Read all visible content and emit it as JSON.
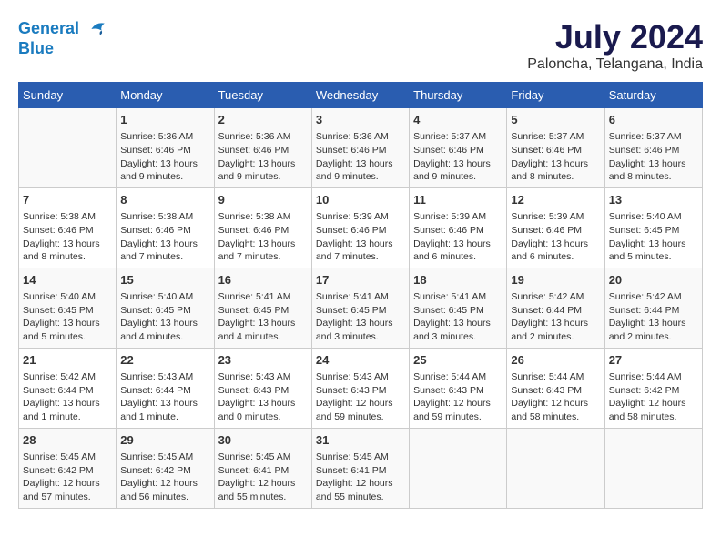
{
  "logo": {
    "line1": "General",
    "line2": "Blue"
  },
  "title": "July 2024",
  "subtitle": "Paloncha, Telangana, India",
  "headers": [
    "Sunday",
    "Monday",
    "Tuesday",
    "Wednesday",
    "Thursday",
    "Friday",
    "Saturday"
  ],
  "weeks": [
    [
      {
        "day": "",
        "info": ""
      },
      {
        "day": "1",
        "info": "Sunrise: 5:36 AM\nSunset: 6:46 PM\nDaylight: 13 hours\nand 9 minutes."
      },
      {
        "day": "2",
        "info": "Sunrise: 5:36 AM\nSunset: 6:46 PM\nDaylight: 13 hours\nand 9 minutes."
      },
      {
        "day": "3",
        "info": "Sunrise: 5:36 AM\nSunset: 6:46 PM\nDaylight: 13 hours\nand 9 minutes."
      },
      {
        "day": "4",
        "info": "Sunrise: 5:37 AM\nSunset: 6:46 PM\nDaylight: 13 hours\nand 9 minutes."
      },
      {
        "day": "5",
        "info": "Sunrise: 5:37 AM\nSunset: 6:46 PM\nDaylight: 13 hours\nand 8 minutes."
      },
      {
        "day": "6",
        "info": "Sunrise: 5:37 AM\nSunset: 6:46 PM\nDaylight: 13 hours\nand 8 minutes."
      }
    ],
    [
      {
        "day": "7",
        "info": "Sunrise: 5:38 AM\nSunset: 6:46 PM\nDaylight: 13 hours\nand 8 minutes."
      },
      {
        "day": "8",
        "info": "Sunrise: 5:38 AM\nSunset: 6:46 PM\nDaylight: 13 hours\nand 7 minutes."
      },
      {
        "day": "9",
        "info": "Sunrise: 5:38 AM\nSunset: 6:46 PM\nDaylight: 13 hours\nand 7 minutes."
      },
      {
        "day": "10",
        "info": "Sunrise: 5:39 AM\nSunset: 6:46 PM\nDaylight: 13 hours\nand 7 minutes."
      },
      {
        "day": "11",
        "info": "Sunrise: 5:39 AM\nSunset: 6:46 PM\nDaylight: 13 hours\nand 6 minutes."
      },
      {
        "day": "12",
        "info": "Sunrise: 5:39 AM\nSunset: 6:46 PM\nDaylight: 13 hours\nand 6 minutes."
      },
      {
        "day": "13",
        "info": "Sunrise: 5:40 AM\nSunset: 6:45 PM\nDaylight: 13 hours\nand 5 minutes."
      }
    ],
    [
      {
        "day": "14",
        "info": "Sunrise: 5:40 AM\nSunset: 6:45 PM\nDaylight: 13 hours\nand 5 minutes."
      },
      {
        "day": "15",
        "info": "Sunrise: 5:40 AM\nSunset: 6:45 PM\nDaylight: 13 hours\nand 4 minutes."
      },
      {
        "day": "16",
        "info": "Sunrise: 5:41 AM\nSunset: 6:45 PM\nDaylight: 13 hours\nand 4 minutes."
      },
      {
        "day": "17",
        "info": "Sunrise: 5:41 AM\nSunset: 6:45 PM\nDaylight: 13 hours\nand 3 minutes."
      },
      {
        "day": "18",
        "info": "Sunrise: 5:41 AM\nSunset: 6:45 PM\nDaylight: 13 hours\nand 3 minutes."
      },
      {
        "day": "19",
        "info": "Sunrise: 5:42 AM\nSunset: 6:44 PM\nDaylight: 13 hours\nand 2 minutes."
      },
      {
        "day": "20",
        "info": "Sunrise: 5:42 AM\nSunset: 6:44 PM\nDaylight: 13 hours\nand 2 minutes."
      }
    ],
    [
      {
        "day": "21",
        "info": "Sunrise: 5:42 AM\nSunset: 6:44 PM\nDaylight: 13 hours\nand 1 minute."
      },
      {
        "day": "22",
        "info": "Sunrise: 5:43 AM\nSunset: 6:44 PM\nDaylight: 13 hours\nand 1 minute."
      },
      {
        "day": "23",
        "info": "Sunrise: 5:43 AM\nSunset: 6:43 PM\nDaylight: 13 hours\nand 0 minutes."
      },
      {
        "day": "24",
        "info": "Sunrise: 5:43 AM\nSunset: 6:43 PM\nDaylight: 12 hours\nand 59 minutes."
      },
      {
        "day": "25",
        "info": "Sunrise: 5:44 AM\nSunset: 6:43 PM\nDaylight: 12 hours\nand 59 minutes."
      },
      {
        "day": "26",
        "info": "Sunrise: 5:44 AM\nSunset: 6:43 PM\nDaylight: 12 hours\nand 58 minutes."
      },
      {
        "day": "27",
        "info": "Sunrise: 5:44 AM\nSunset: 6:42 PM\nDaylight: 12 hours\nand 58 minutes."
      }
    ],
    [
      {
        "day": "28",
        "info": "Sunrise: 5:45 AM\nSunset: 6:42 PM\nDaylight: 12 hours\nand 57 minutes."
      },
      {
        "day": "29",
        "info": "Sunrise: 5:45 AM\nSunset: 6:42 PM\nDaylight: 12 hours\nand 56 minutes."
      },
      {
        "day": "30",
        "info": "Sunrise: 5:45 AM\nSunset: 6:41 PM\nDaylight: 12 hours\nand 55 minutes."
      },
      {
        "day": "31",
        "info": "Sunrise: 5:45 AM\nSunset: 6:41 PM\nDaylight: 12 hours\nand 55 minutes."
      },
      {
        "day": "",
        "info": ""
      },
      {
        "day": "",
        "info": ""
      },
      {
        "day": "",
        "info": ""
      }
    ]
  ]
}
